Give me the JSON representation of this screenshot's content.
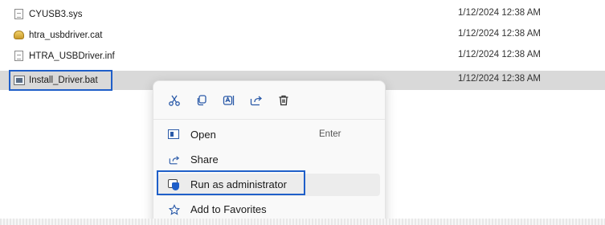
{
  "files": [
    {
      "name": "CYUSB3.sys",
      "date": "1/12/2024 12:38 AM",
      "icon": "sys-file-icon"
    },
    {
      "name": "htra_usbdriver.cat",
      "date": "1/12/2024 12:38 AM",
      "icon": "security-catalog-icon"
    },
    {
      "name": "HTRA_USBDriver.inf",
      "date": "1/12/2024 12:38 AM",
      "icon": "setup-info-icon"
    },
    {
      "name": "Install_Driver.bat",
      "date": "1/12/2024 12:38 AM",
      "icon": "batch-file-icon",
      "selected": true
    }
  ],
  "context_menu": {
    "quick_actions": [
      "cut-icon",
      "copy-icon",
      "rename-icon",
      "share-icon",
      "delete-icon"
    ],
    "items": [
      {
        "label": "Open",
        "shortcut": "Enter",
        "icon": "open-icon"
      },
      {
        "label": "Share",
        "icon": "share-icon"
      },
      {
        "label": "Run as administrator",
        "icon": "run-as-admin-icon"
      },
      {
        "label": "Add to Favorites",
        "icon": "star-icon"
      }
    ]
  },
  "colors": {
    "highlight": "#1f5fc9",
    "selected_row": "#d9d9d9",
    "accent_icon": "#2b5aa8"
  }
}
